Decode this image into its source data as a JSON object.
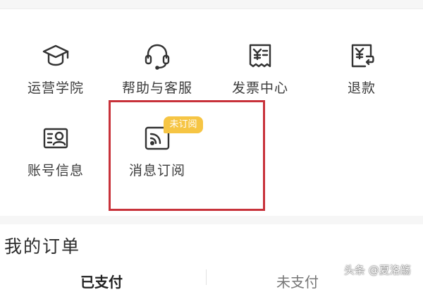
{
  "services": [
    {
      "label": "运营学院",
      "icon": "graduation-cap-icon"
    },
    {
      "label": "帮助与客服",
      "icon": "headset-icon"
    },
    {
      "label": "发票中心",
      "icon": "invoice-icon"
    },
    {
      "label": "退款",
      "icon": "refund-icon"
    },
    {
      "label": "账号信息",
      "icon": "account-card-icon"
    },
    {
      "label": "消息订阅",
      "icon": "rss-icon",
      "badge": "未订阅"
    }
  ],
  "orders": {
    "title": "我的订单",
    "tabs": [
      "已支付",
      "未支付"
    ]
  },
  "watermark": "头条 @夏洛觞",
  "colors": {
    "highlight": "#c8323a",
    "badge": "#f6c544",
    "icon": "#333333"
  }
}
